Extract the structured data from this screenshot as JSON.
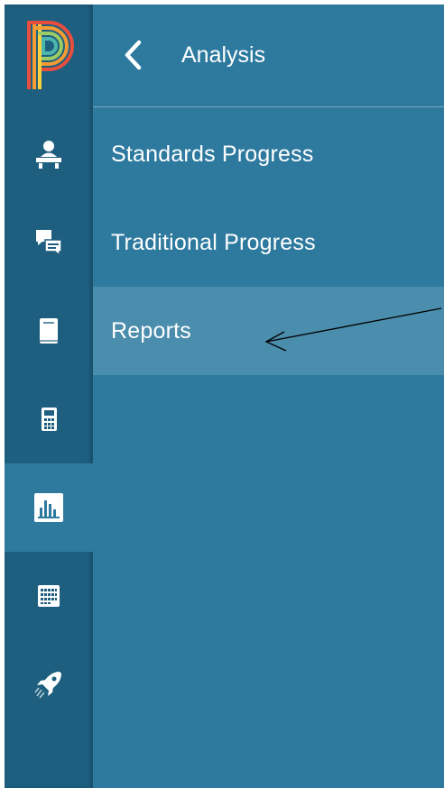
{
  "app": {
    "logo": "powerschool-p-logo"
  },
  "rail": {
    "items": [
      {
        "icon": "teacher-desk-icon",
        "active": false
      },
      {
        "icon": "chat-bubbles-icon",
        "active": false
      },
      {
        "icon": "book-icon",
        "active": false
      },
      {
        "icon": "calculator-icon",
        "active": false
      },
      {
        "icon": "bar-chart-icon",
        "active": true
      },
      {
        "icon": "calendar-icon",
        "active": false
      },
      {
        "icon": "rocket-icon",
        "active": false
      }
    ]
  },
  "panel": {
    "back_icon": "chevron-left-icon",
    "title": "Analysis",
    "items": [
      {
        "label": "Standards Progress",
        "selected": false
      },
      {
        "label": "Traditional Progress",
        "selected": false
      },
      {
        "label": "Reports",
        "selected": true
      }
    ]
  },
  "colors": {
    "rail_bg": "#1e5f80",
    "panel_bg": "#2e7a9f",
    "selected_item_bg": "#4b8dac",
    "text": "#ffffff"
  },
  "annotation": {
    "type": "arrow",
    "points_to": "Reports"
  }
}
